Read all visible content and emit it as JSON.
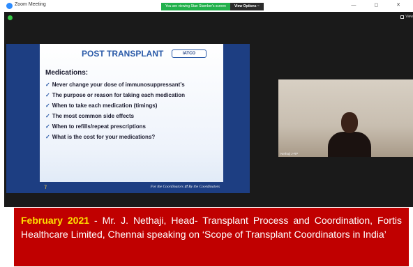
{
  "window": {
    "app_title": "Zoom Meeting",
    "share_notice": "You are viewing Stan Stamber's screen",
    "view_options": "View Options ~",
    "view_button": "View",
    "controls": "— ◻ ✕"
  },
  "slide": {
    "title": "POST TRANSPLANT",
    "logo_text": "IATCO",
    "heading": "Medications:",
    "bullets": [
      "Never change your dose of  immunosuppressant’s",
      "The purpose or reason for taking each medication",
      "When to take each medication (timings)",
      "The most common side effects",
      "When to refills/repeat prescriptions",
      "What is the cost for your medications?"
    ],
    "footer": "For the Coordinators ⇄ By the Coordinators"
  },
  "video": {
    "participant_name": "Nethaji J-RP"
  },
  "caption": {
    "date": "February 2021",
    "text": " - Mr. J. Nethaji, Head- Transplant Process and Coordination, Fortis Healthcare Limited, Chennai speaking on ‘Scope of Transplant Coordinators in India’"
  },
  "colors": {
    "caption_bg": "#c00000",
    "caption_date": "#ffe100",
    "share_green": "#22b14c",
    "slide_blue": "#1d3e82"
  }
}
